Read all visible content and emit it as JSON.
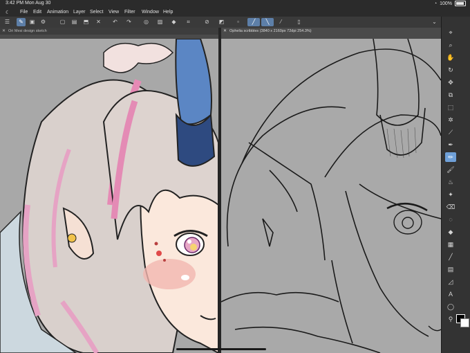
{
  "status": {
    "time": "3:42 PM",
    "date": "Mon Aug 30",
    "battery": "100%"
  },
  "menu": [
    "File",
    "Edit",
    "Animation",
    "Layer",
    "Select",
    "View",
    "Filter",
    "Window",
    "Help"
  ],
  "tabs": [
    {
      "label": "Ori Mesi design sketch"
    },
    {
      "label": "Ophelia scribbles (3840 x 2160px 72dpi 254.3%)"
    }
  ],
  "tools": [
    "pointer-icon",
    "zoom-icon",
    "hand-icon",
    "rotate-icon",
    "move-icon",
    "layer-move-icon",
    "selection-icon",
    "eyedropper-icon",
    "pen-icon",
    "pencil-icon",
    "brush-icon",
    "airbrush-icon",
    "decoration-icon",
    "eraser-icon",
    "blend-icon",
    "fill-icon",
    "gradient-icon",
    "figure-icon",
    "frame-icon",
    "ruler-icon",
    "text-icon",
    "balloon-icon",
    "correction-icon"
  ],
  "colors": {
    "fg": "#000000",
    "bg": "#ffffff",
    "accent": "#5d7fa8"
  }
}
